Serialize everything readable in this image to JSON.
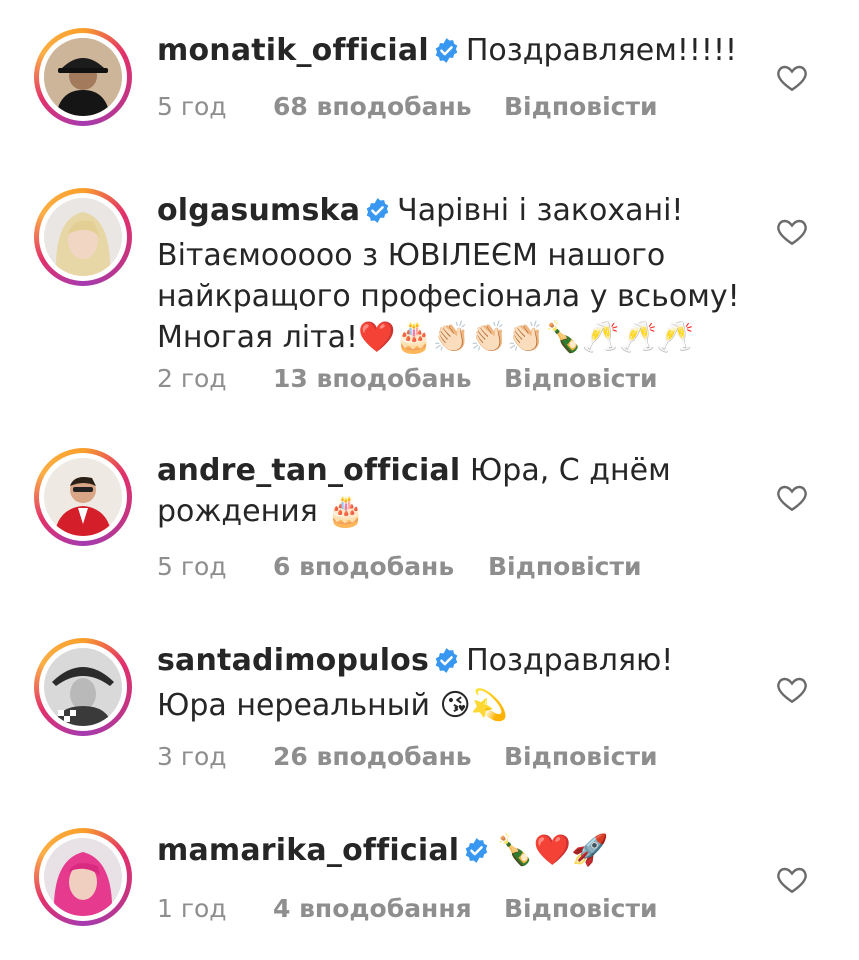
{
  "comments": [
    {
      "username": "monatik_official",
      "verified": true,
      "text": "Поздравляем!!!!!",
      "time": "5 год",
      "likes": "68 вподобань",
      "reply": "Відповісти"
    },
    {
      "username": "olgasumska",
      "verified": true,
      "text": "Чарівні і закохані! Вітаємооооо з ЮВІЛЕЄМ нашого найкращого професіонала у всьому! Многая літа!❤️🎂👏🏻👏🏻👏🏻🍾🥂🥂🥂",
      "time": "2 год",
      "likes": "13 вподобань",
      "reply": "Відповісти"
    },
    {
      "username": "andre_tan_official",
      "verified": false,
      "text": "Юра, С днём рождения 🎂",
      "time": "5 год",
      "likes": "6 вподобань",
      "reply": "Відповісти"
    },
    {
      "username": "santadimopulos",
      "verified": true,
      "text": "Поздравляю! Юра нереальный 😘💫",
      "time": "3 год",
      "likes": "26 вподобань",
      "reply": "Відповісти"
    },
    {
      "username": "mamarika_official",
      "verified": true,
      "text": "🍾❤️🚀",
      "time": "1 год",
      "likes": "4 вподобання",
      "reply": "Відповісти"
    }
  ],
  "icons": {
    "like": "heart-outline-icon",
    "verified": "verified-badge-icon"
  },
  "colors": {
    "verified_blue": "#3897f0",
    "meta_gray": "#8e8e8e",
    "text": "#262626"
  }
}
